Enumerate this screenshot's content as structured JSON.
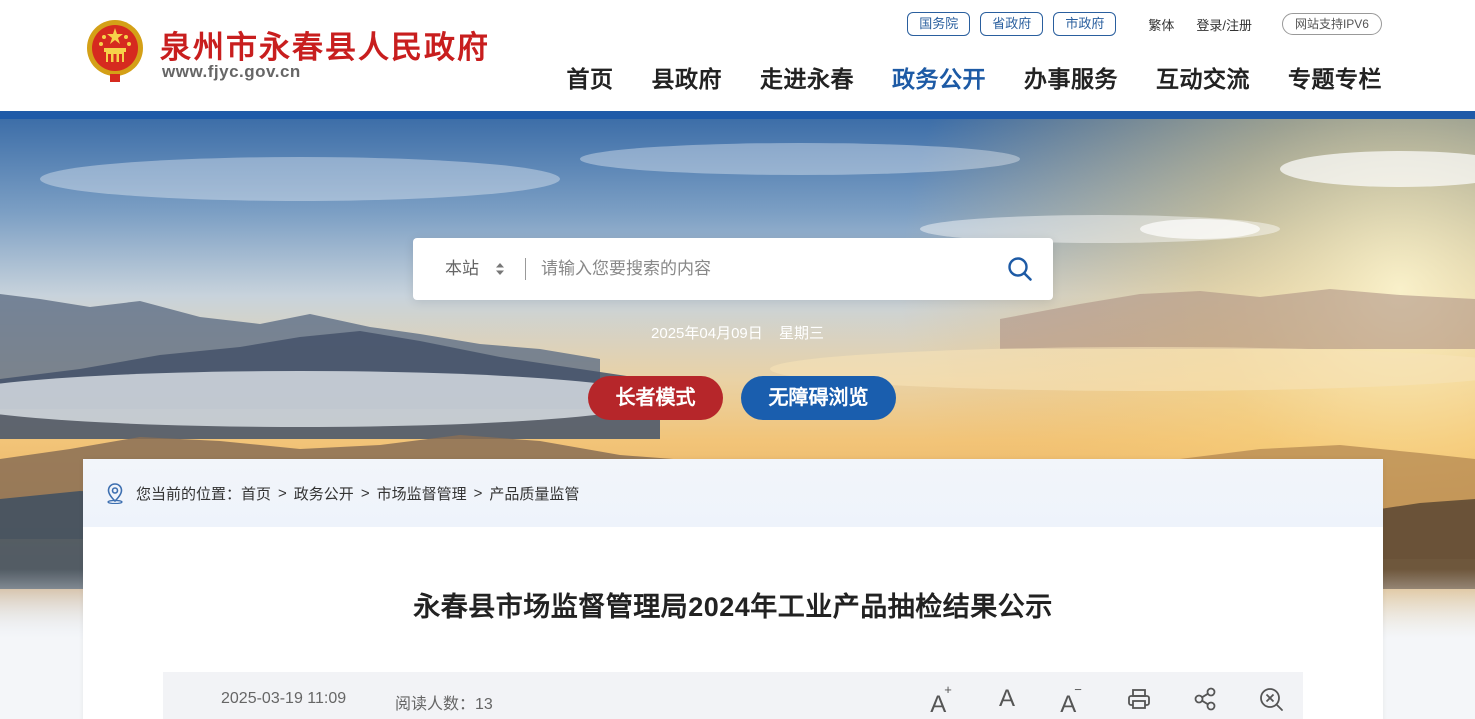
{
  "header": {
    "site_title": "泉州市永春县人民政府",
    "site_url": "www.fjyc.gov.cn",
    "top_links": [
      "国务院",
      "省政府",
      "市政府"
    ],
    "traditional": "繁体",
    "login": "登录/注册",
    "ipv6": "网站支持IPV6",
    "nav": [
      {
        "label": "首页",
        "active": false
      },
      {
        "label": "县政府",
        "active": false
      },
      {
        "label": "走进永春",
        "active": false
      },
      {
        "label": "政务公开",
        "active": true
      },
      {
        "label": "办事服务",
        "active": false
      },
      {
        "label": "互动交流",
        "active": false
      },
      {
        "label": "专题专栏",
        "active": false
      }
    ]
  },
  "search": {
    "scope": "本站",
    "placeholder": "请输入您要搜索的内容",
    "value": ""
  },
  "date": {
    "date": "2025年04月09日",
    "weekday": "星期三"
  },
  "modes": {
    "elder": "长者模式",
    "accessible": "无障碍浏览"
  },
  "breadcrumb": {
    "prefix": "您当前的位置：",
    "items": [
      "首页",
      "政务公开",
      "市场监督管理",
      "产品质量监管"
    ],
    "separator": ">"
  },
  "article": {
    "title": "永春县市场监督管理局2024年工业产品抽检结果公示",
    "published": "2025-03-19 11:09",
    "reads": "阅读人数：13"
  },
  "tools": {
    "font_large": "A",
    "font_normal": "A",
    "font_small": "A",
    "plus": "+",
    "minus": "−"
  },
  "colors": {
    "brand_red": "#c81e1e",
    "brand_blue": "#1f5aa8",
    "nav_active": "#1d5aa5",
    "elder_button": "#b6262a",
    "accessible_button": "#1a5eae"
  }
}
